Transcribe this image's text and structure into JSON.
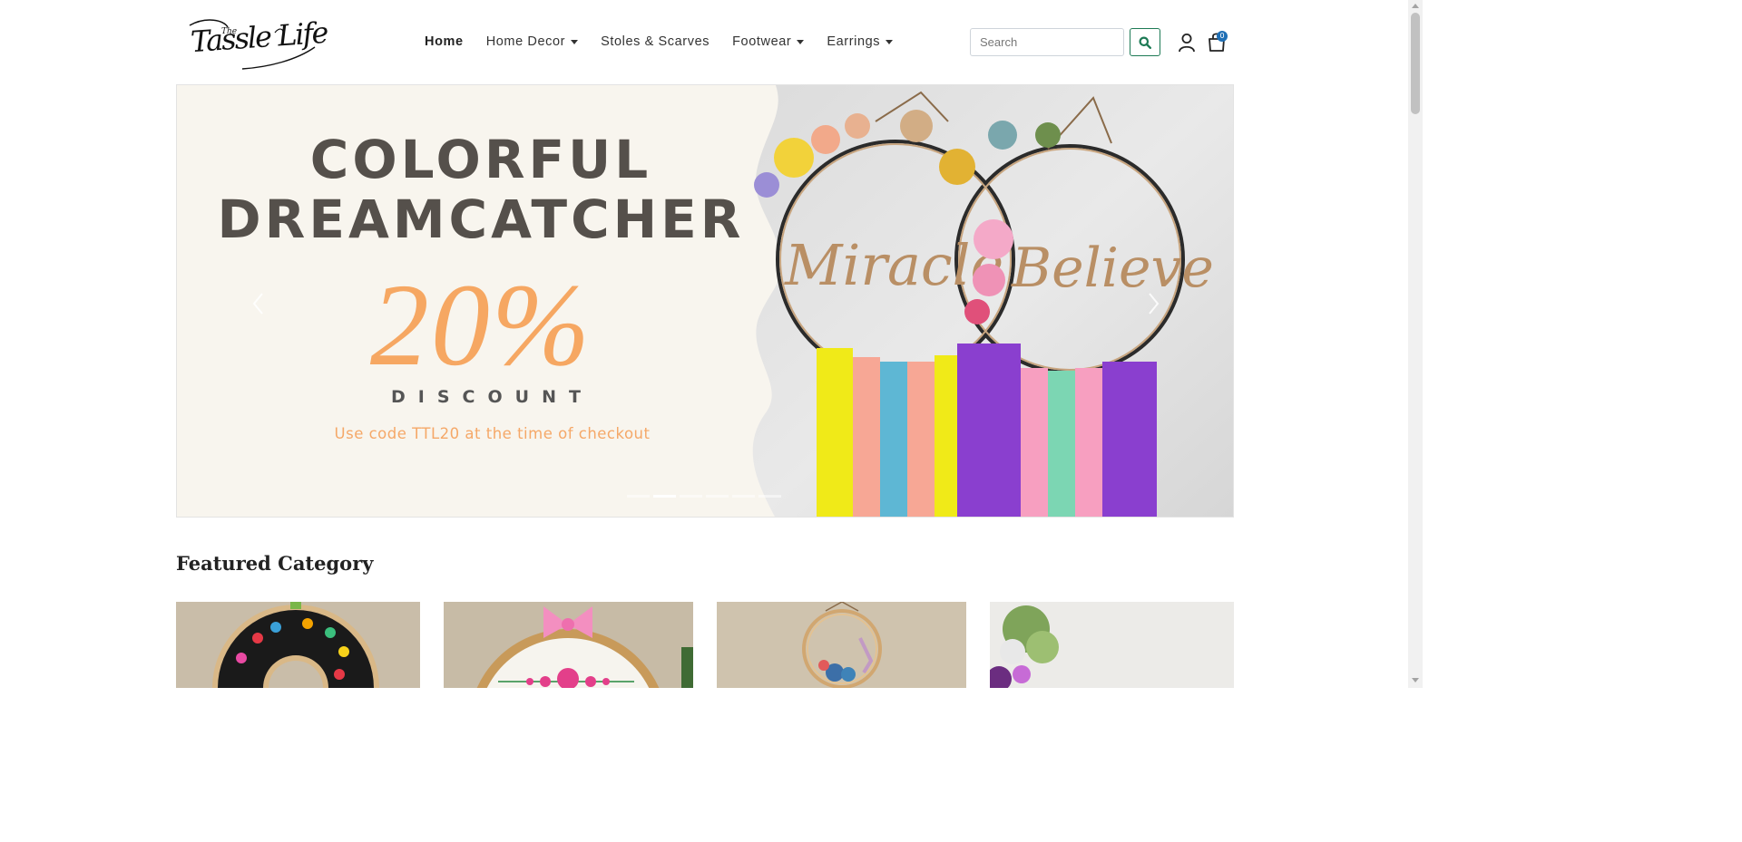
{
  "brand": {
    "logo_small": "The",
    "logo_main": "Tassle Life"
  },
  "nav": {
    "items": [
      {
        "label": "Home",
        "active": true,
        "dropdown": false
      },
      {
        "label": "Home Decor",
        "active": false,
        "dropdown": true
      },
      {
        "label": "Stoles & Scarves",
        "active": false,
        "dropdown": false
      },
      {
        "label": "Footwear",
        "active": false,
        "dropdown": true
      },
      {
        "label": "Earrings",
        "active": false,
        "dropdown": true
      }
    ]
  },
  "search": {
    "placeholder": "Search",
    "value": "",
    "button_icon": "search-icon"
  },
  "account": {
    "icon": "user-icon"
  },
  "cart": {
    "icon": "shopping-bag-icon",
    "count": "0"
  },
  "hero": {
    "title_line1": "COLORFUL",
    "title_line2": "DREAMCATCHER",
    "discount_value": "20%",
    "discount_label": "DISCOUNT",
    "code_text": "Use code TTL20 at the time of checkout",
    "image_words": [
      "Miracle",
      "Believe"
    ],
    "slide_count": 6,
    "active_slide": 2,
    "prev_icon": "chevron-left-icon",
    "next_icon": "chevron-right-icon"
  },
  "featured": {
    "title": "Featured Category",
    "cards": [
      {
        "name": "embroidery-hoop-black"
      },
      {
        "name": "embroidery-hoop-pink-bow"
      },
      {
        "name": "wreath-hoop-blue-flowers"
      },
      {
        "name": "dreamcatcher-flowers"
      }
    ]
  },
  "colors": {
    "accent_green": "#1d7a55",
    "badge_blue": "#1f6fb5",
    "hero_title": "#55504b",
    "hero_orange": "#f6a762"
  }
}
